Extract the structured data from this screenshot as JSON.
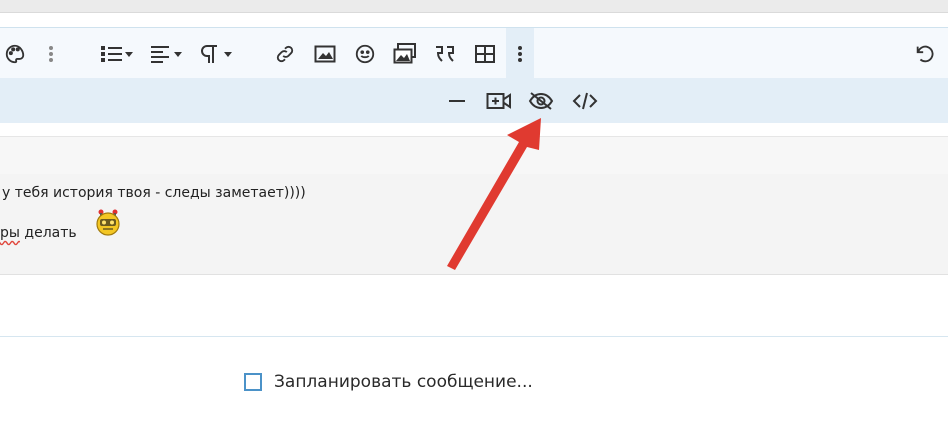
{
  "toolbar": {
    "icons": [
      "palette-icon",
      "more-vertical-icon",
      "bulleted-list-icon",
      "align-left-icon",
      "paragraph-icon",
      "link-icon",
      "image-icon",
      "smiley-icon",
      "media-icon",
      "quote-icon",
      "table-icon",
      "more-vertical-icon",
      "undo-icon"
    ]
  },
  "subbar": {
    "icons": [
      "horizontal-line-icon",
      "insert-video-icon",
      "hide-content-icon",
      "source-code-icon"
    ]
  },
  "message": {
    "line1": "у тебя история твоя - следы заметает))))",
    "line2_misspelled": "ры",
    "line2_rest": " делать",
    "smiley": "emoji-robot"
  },
  "schedule": {
    "label": "Запланировать сообщение..."
  },
  "colors": {
    "accent": "#4b92c8",
    "toolbar_bg": "#f5f9fd",
    "subbar_bg": "#e3eef7",
    "arrow": "#e03a30"
  }
}
